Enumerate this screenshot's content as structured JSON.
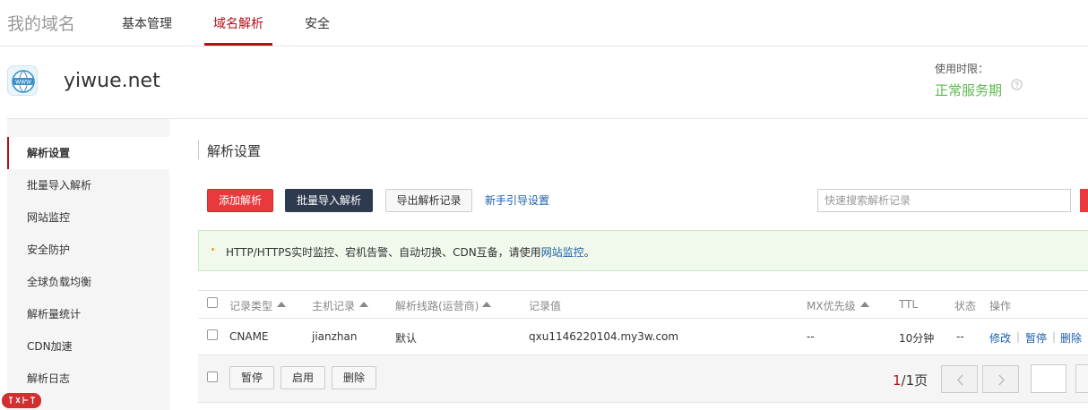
{
  "topnav": {
    "brand": "我的域名",
    "tabs": [
      {
        "label": "基本管理",
        "active": false
      },
      {
        "label": "域名解析",
        "active": true
      },
      {
        "label": "安全",
        "active": false
      }
    ]
  },
  "domain": {
    "name": "yiwue.net",
    "term_label": "使用时限：",
    "term_value": "正常服务期",
    "icon_text": "WWW"
  },
  "sidebar": {
    "items": [
      {
        "label": "解析设置",
        "active": true
      },
      {
        "label": "批量导入解析",
        "active": false
      },
      {
        "label": "网站监控",
        "active": false
      },
      {
        "label": "安全防护",
        "active": false
      },
      {
        "label": "全球负载均衡",
        "active": false
      },
      {
        "label": "解析量统计",
        "active": false
      },
      {
        "label": "CDN加速",
        "active": false
      },
      {
        "label": "解析日志",
        "active": false
      }
    ]
  },
  "main": {
    "title": "解析设置",
    "toolbar": {
      "add": "添加解析",
      "batch_import": "批量导入解析",
      "export": "导出解析记录",
      "guide": "新手引导设置"
    },
    "search": {
      "placeholder": "快速搜索解析记录",
      "value": ""
    },
    "notice": {
      "text": "HTTP/HTTPS实时监控、宕机告警、自动切换、CDN互备，请使用",
      "link": "网站监控",
      "end": "。"
    },
    "table": {
      "headers": {
        "type": "记录类型",
        "host": "主机记录",
        "line": "解析线路(运营商)",
        "value": "记录值",
        "mx": "MX优先级",
        "ttl": "TTL",
        "status": "状态",
        "ops": "操作"
      },
      "rows": [
        {
          "type": "CNAME",
          "host": "jianzhan",
          "line": "默认",
          "value": "qxu1146220104.my3w.com",
          "mx": "--",
          "ttl": "10分钟",
          "status": "--",
          "ops": {
            "edit": "修改",
            "pause": "暂停",
            "delete": "删除"
          }
        }
      ]
    },
    "footer": {
      "pause": "暂停",
      "enable": "启用",
      "delete": "删除",
      "page_current": "1",
      "page_total": "/1页"
    }
  },
  "colors": {
    "accent": "#b4101a",
    "red_button": "#e8393c",
    "dark_button": "#2e3b4e",
    "link": "#1a5fa8",
    "status_green": "#5db94f"
  }
}
